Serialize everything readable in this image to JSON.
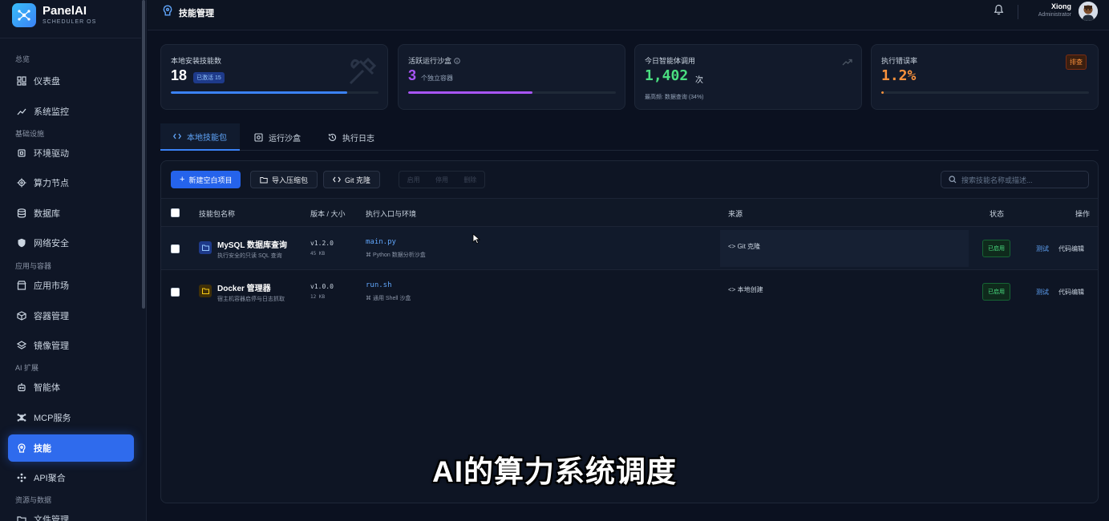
{
  "brand": {
    "name": "PanelAI",
    "subtitle": "SCHEDULER OS"
  },
  "sidebar": {
    "groups": {
      "overview": "总览",
      "infra": "基础设施",
      "apps": "应用与容器",
      "ai": "AI 扩展",
      "resources": "资源与数据"
    },
    "items": [
      {
        "label": "仪表盘",
        "icon": "dashboard-icon"
      },
      {
        "label": "系统监控",
        "icon": "trend-icon"
      },
      {
        "label": "环境驱动",
        "icon": "chip-icon"
      },
      {
        "label": "算力节点",
        "icon": "cpu-icon"
      },
      {
        "label": "数据库",
        "icon": "database-icon"
      },
      {
        "label": "网络安全",
        "icon": "shield-icon"
      },
      {
        "label": "应用市场",
        "icon": "store-icon"
      },
      {
        "label": "容器管理",
        "icon": "box-icon"
      },
      {
        "label": "镜像管理",
        "icon": "layers-icon"
      },
      {
        "label": "智能体",
        "icon": "robot-icon"
      },
      {
        "label": "MCP服务",
        "icon": "network-icon"
      },
      {
        "label": "技能",
        "icon": "skill-icon"
      },
      {
        "label": "API聚合",
        "icon": "api-icon"
      },
      {
        "label": "文件管理",
        "icon": "folder-icon"
      }
    ]
  },
  "header": {
    "title": "技能管理",
    "user_name": "Xiong",
    "user_role": "Administrator"
  },
  "stats": {
    "installed": {
      "label": "本地安装技能数",
      "value": "18",
      "badge": "已激活 15",
      "progress": 0.85
    },
    "sandbox": {
      "label": "活跃运行沙盒",
      "value": "3",
      "sub": "个独立容器",
      "progress": 0.6
    },
    "calls": {
      "label": "今日智能体调用",
      "value": "1,402",
      "unit": "次",
      "sub": "最高频: 数据查询 (34%)"
    },
    "errors": {
      "label": "执行错误率",
      "value": "1.2%",
      "badge": "排查",
      "progress": 0.012
    }
  },
  "tabs": [
    "本地技能包",
    "运行沙盒",
    "执行日志"
  ],
  "toolbar": {
    "new_label": "新建空白项目",
    "import_label": "导入压缩包",
    "git_label": "Git 克隆",
    "batch": [
      "启用",
      "停用",
      "删除"
    ],
    "search_placeholder": "搜索技能名称或描述..."
  },
  "table": {
    "headers": [
      "技能包名称",
      "版本 / 大小",
      "执行入口与环境",
      "来源",
      "状态",
      "操作"
    ],
    "rows": [
      {
        "name": "MySQL 数据库查询",
        "desc": "执行安全的只读 SQL 查询",
        "version": "v1.2.0",
        "size": "45 KB",
        "entry": "main.py",
        "env": "Python 数据分析沙盒",
        "source": "Git 克隆",
        "status": "已启用",
        "test": "测试",
        "edit": "代码编辑"
      },
      {
        "name": "Docker 管理器",
        "desc": "宿主机容器启停与日志抓取",
        "version": "v1.0.0",
        "size": "12 KB",
        "entry": "run.sh",
        "env": "通用 Shell 沙盒",
        "source": "本地创建",
        "status": "已启用",
        "test": "测试",
        "edit": "代码编辑"
      }
    ]
  },
  "caption": "AI的算力系统调度",
  "colors": {
    "accent": "#2f6bed",
    "success": "#4ade80",
    "purple": "#a855f7",
    "green": "#4ade80",
    "orange": "#fb923c"
  }
}
